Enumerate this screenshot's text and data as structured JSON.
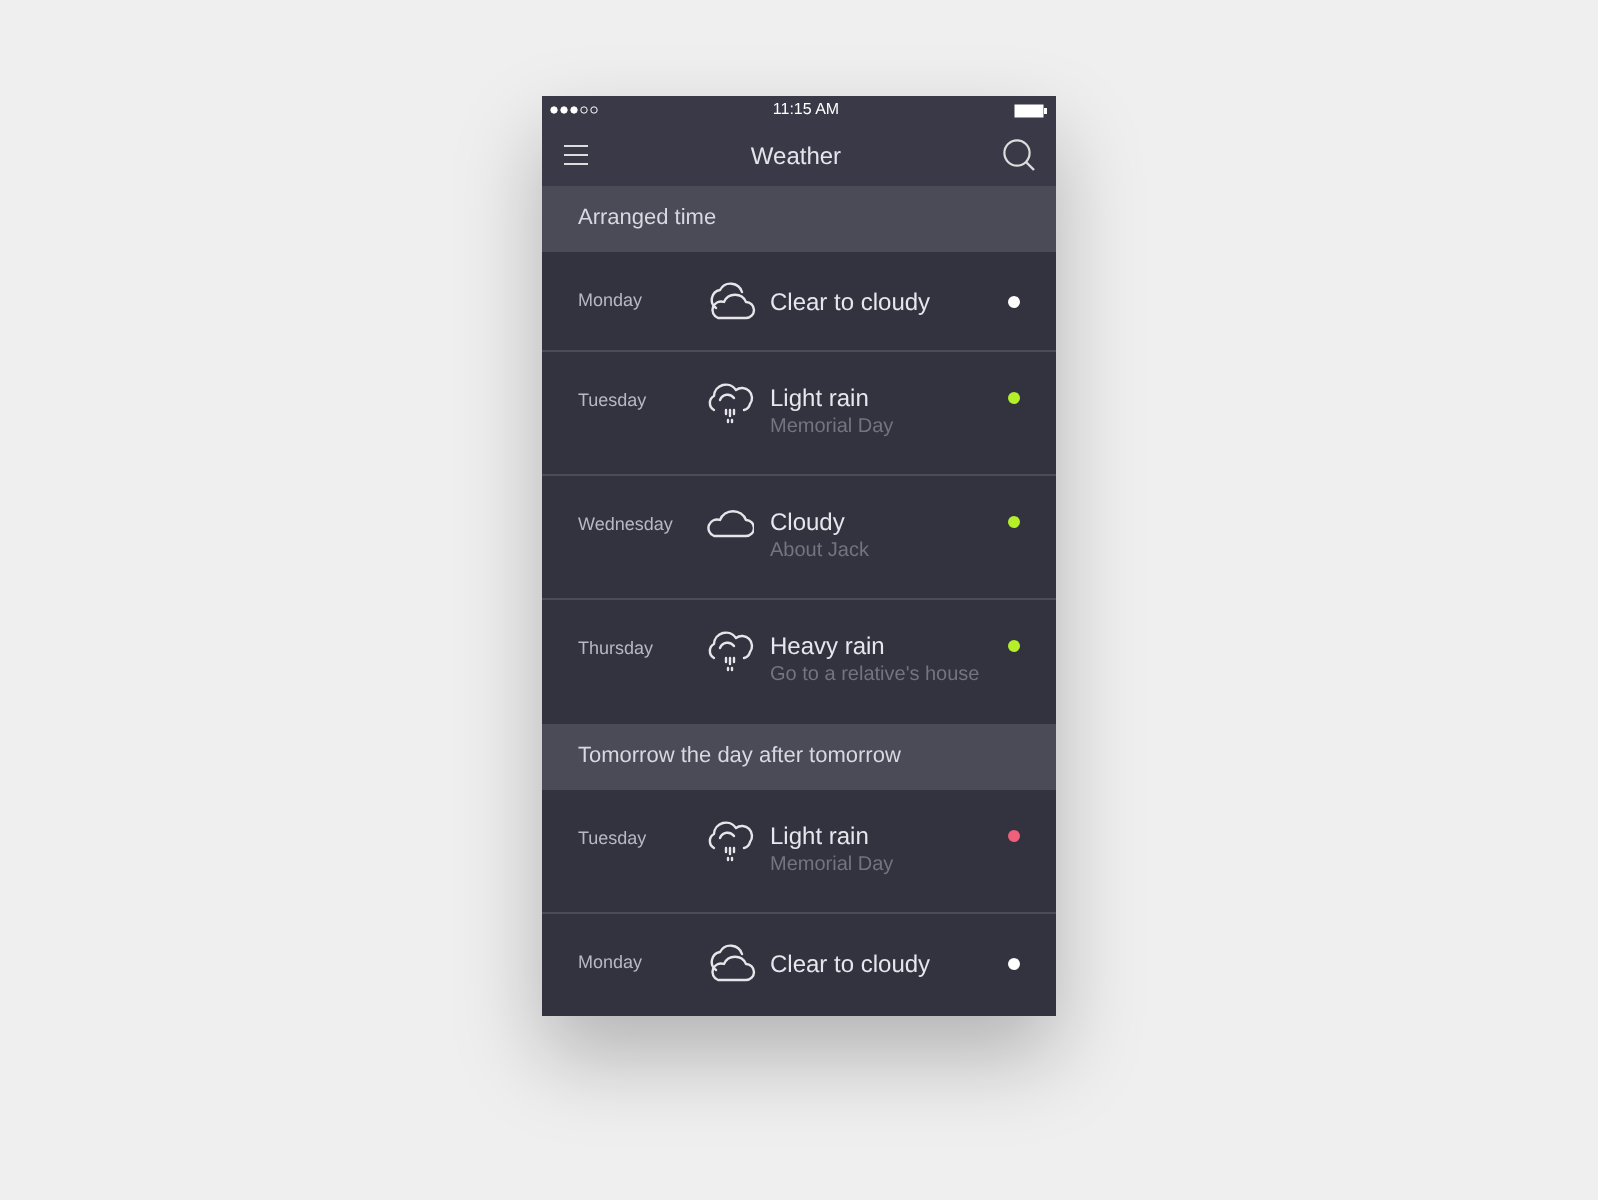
{
  "status_bar": {
    "time": "11:15 AM"
  },
  "nav": {
    "title": "Weather"
  },
  "sections": [
    {
      "title": "Arranged time",
      "items": [
        {
          "day": "Monday",
          "kind": "clouds",
          "title": "Clear to cloudy",
          "color": "#ffffff"
        },
        {
          "day": "Tuesday",
          "kind": "rain",
          "title": "Light rain",
          "subtitle": "Memorial Day",
          "color": "#b4f02a"
        },
        {
          "day": "Wednesday",
          "kind": "cloud",
          "title": "Cloudy",
          "subtitle": "About Jack",
          "color": "#b4f02a"
        },
        {
          "day": "Thursday",
          "kind": "rain",
          "title": "Heavy rain",
          "subtitle": "Go to a relative's house",
          "color": "#b4f02a"
        }
      ]
    },
    {
      "title": "Tomorrow the day after tomorrow",
      "items": [
        {
          "day": "Tuesday",
          "kind": "rain",
          "title": "Light rain",
          "subtitle": "Memorial Day",
          "color": "#f0607a"
        },
        {
          "day": "Monday",
          "kind": "clouds",
          "title": "Clear to cloudy",
          "color": "#ffffff"
        }
      ]
    }
  ]
}
